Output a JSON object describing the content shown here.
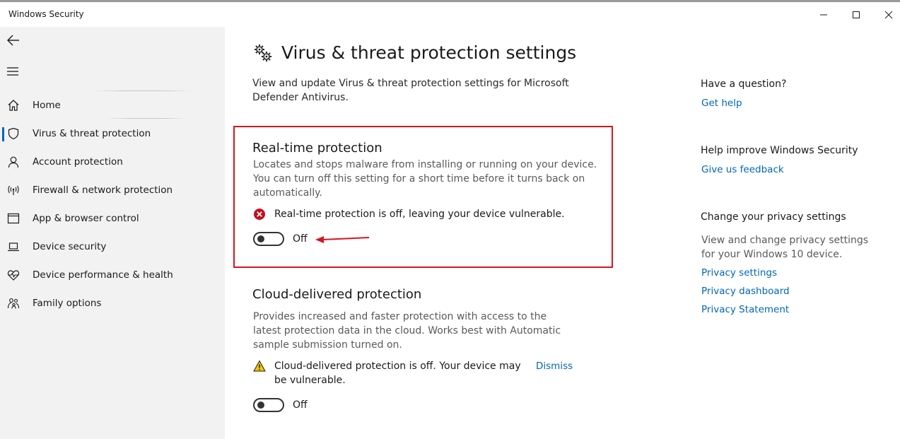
{
  "window": {
    "title": "Windows Security"
  },
  "sidebar": {
    "items": [
      {
        "label": "Home",
        "icon": "home-icon"
      },
      {
        "label": "Virus & threat protection",
        "icon": "shield-icon",
        "selected": true
      },
      {
        "label": "Account protection",
        "icon": "person-icon"
      },
      {
        "label": "Firewall & network protection",
        "icon": "antenna-icon"
      },
      {
        "label": "App & browser control",
        "icon": "window-icon"
      },
      {
        "label": "Device security",
        "icon": "laptop-icon"
      },
      {
        "label": "Device performance & health",
        "icon": "heartbeat-icon"
      },
      {
        "label": "Family options",
        "icon": "family-icon"
      }
    ]
  },
  "main": {
    "title": "Virus & threat protection settings",
    "description": "View and update Virus & threat protection settings for Microsoft Defender Antivirus.",
    "realtime": {
      "title": "Real-time protection",
      "description": "Locates and stops malware from installing or running on your device. You can turn off this setting for a short time before it turns back on automatically.",
      "status": "Real-time protection is off, leaving your device vulnerable.",
      "toggle_label": "Off",
      "toggle_on": false
    },
    "cloud": {
      "title": "Cloud-delivered protection",
      "description": "Provides increased and faster protection with access to the latest protection data in the cloud. Works best with Automatic sample submission turned on.",
      "status": "Cloud-delivered protection is off. Your device may be vulnerable.",
      "dismiss": "Dismiss",
      "toggle_label": "Off",
      "toggle_on": false
    }
  },
  "right_panel": {
    "question_heading": "Have a question?",
    "get_help": "Get help",
    "improve_heading": "Help improve Windows Security",
    "feedback": "Give us feedback",
    "privacy_heading": "Change your privacy settings",
    "privacy_text": "View and change privacy settings for your Windows 10 device.",
    "privacy_settings": "Privacy settings",
    "privacy_dashboard": "Privacy dashboard",
    "privacy_statement": "Privacy Statement"
  },
  "colors": {
    "accent": "#0067b8",
    "error": "#c50f1f",
    "warning": "#f7c600",
    "highlight": "#d9141e"
  }
}
